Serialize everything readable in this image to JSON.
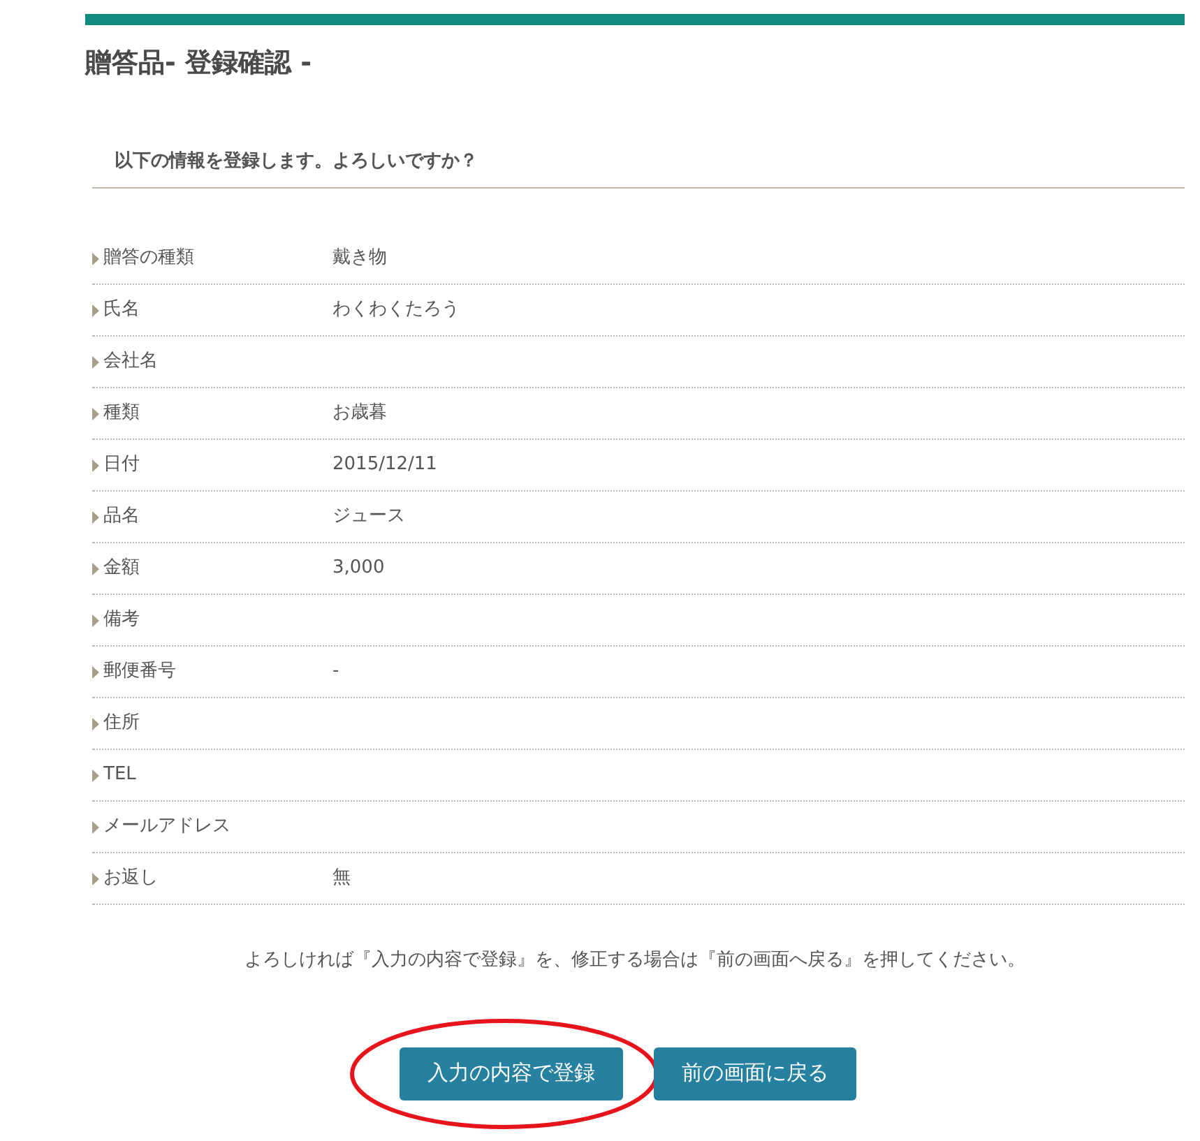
{
  "title": "贈答品- 登録確認 -",
  "subheading": "以下の情報を登録します。よろしいですか？",
  "rows": [
    {
      "label": "贈答の種類",
      "value": "戴き物"
    },
    {
      "label": "氏名",
      "value": "わくわくたろう"
    },
    {
      "label": "会社名"
    },
    {
      "label": "種類",
      "value": "お歳暮"
    },
    {
      "label": "日付",
      "value": "2015/12/11"
    },
    {
      "label": "品名",
      "value": "ジュース"
    },
    {
      "label": "金額",
      "value": "3,000"
    },
    {
      "label": "備考"
    },
    {
      "label": "郵便番号",
      "value": "-"
    },
    {
      "label": "住所"
    },
    {
      "label": "TEL"
    },
    {
      "label": "メールアドレス"
    },
    {
      "label": "お返し",
      "value": "無"
    }
  ],
  "instruction": "よろしければ『入力の内容で登録』を、修正する場合は『前の画面へ戻る』を押してください。",
  "buttons": [
    {
      "label": "入力の内容で登録",
      "highlighted": true
    },
    {
      "label": "前の画面に戻る",
      "highlighted": false
    }
  ]
}
